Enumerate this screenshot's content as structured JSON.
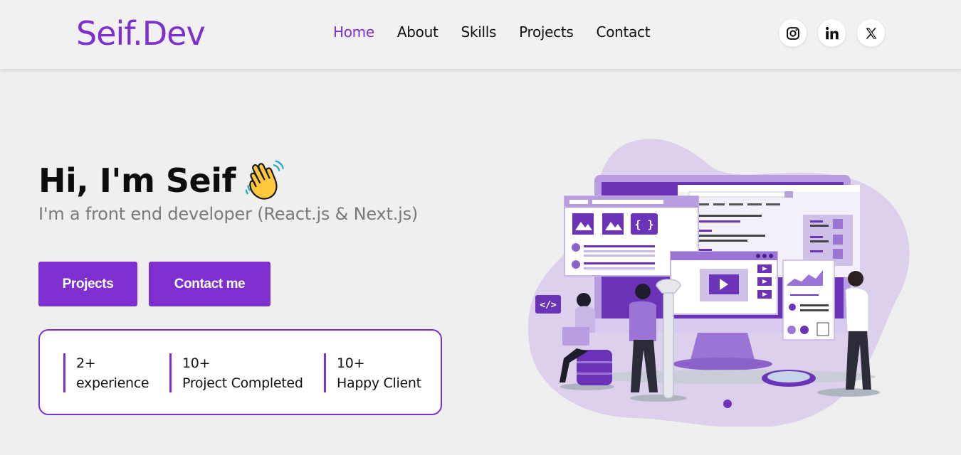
{
  "brand": {
    "logo": "Seif.Dev",
    "accent": "#7e2fd0"
  },
  "nav": {
    "items": [
      {
        "label": "Home",
        "active": true
      },
      {
        "label": "About",
        "active": false
      },
      {
        "label": "Skills",
        "active": false
      },
      {
        "label": "Projects",
        "active": false
      },
      {
        "label": "Contact",
        "active": false
      }
    ]
  },
  "socials": [
    {
      "icon": "instagram-icon"
    },
    {
      "icon": "linkedin-icon"
    },
    {
      "icon": "x-icon"
    }
  ],
  "hero": {
    "title": "Hi, I'm Seif",
    "wave_icon": "waving-hand-icon",
    "subtitle": "I'm a front end developer (React.js & Next.js)",
    "buttons": {
      "projects": "Projects",
      "contact": "Contact me"
    }
  },
  "stats": [
    {
      "value": "2+",
      "label": "experience"
    },
    {
      "value": "10+",
      "label": "Project Completed"
    },
    {
      "value": "10+",
      "label": "Happy Client"
    }
  ],
  "illustration": {
    "code_tag": "</>",
    "braces": "{ }"
  }
}
